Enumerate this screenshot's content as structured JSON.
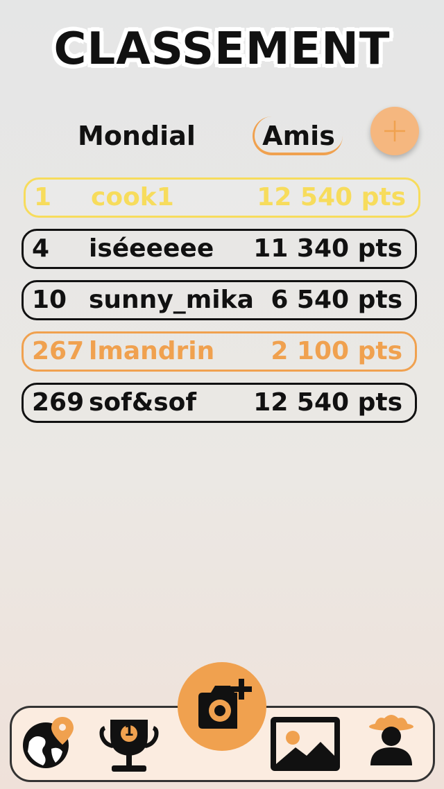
{
  "header": {
    "title": "CLASSEMENT"
  },
  "tabs": [
    {
      "label": "Mondial",
      "active": false
    },
    {
      "label": "Amis",
      "active": true
    }
  ],
  "add_friend": {
    "icon": "plus-icon"
  },
  "leaderboard": [
    {
      "rank": "1",
      "name": "cook1",
      "points": "12 540 pts",
      "style": "gold"
    },
    {
      "rank": "4",
      "name": "iséeeeee",
      "points": "11 340 pts",
      "style": "normal"
    },
    {
      "rank": "10",
      "name": "sunny_mika",
      "points": "6 540 pts",
      "style": "normal"
    },
    {
      "rank": "267",
      "name": "lmandrin",
      "points": "2 100 pts",
      "style": "current-user"
    },
    {
      "rank": "269",
      "name": "sof&sof",
      "points": "12 540 pts",
      "style": "normal"
    }
  ],
  "navbar": {
    "items": [
      {
        "icon": "globe-pin-icon"
      },
      {
        "icon": "trophy-icon",
        "badge": "1"
      },
      {
        "icon": "camera-add-icon"
      },
      {
        "icon": "image-icon"
      },
      {
        "icon": "profile-cowboy-icon"
      }
    ]
  },
  "colors": {
    "accent": "#f0a14f",
    "gold": "#f7dc5c",
    "text": "#111111",
    "nav_bg": "#fbece0"
  }
}
